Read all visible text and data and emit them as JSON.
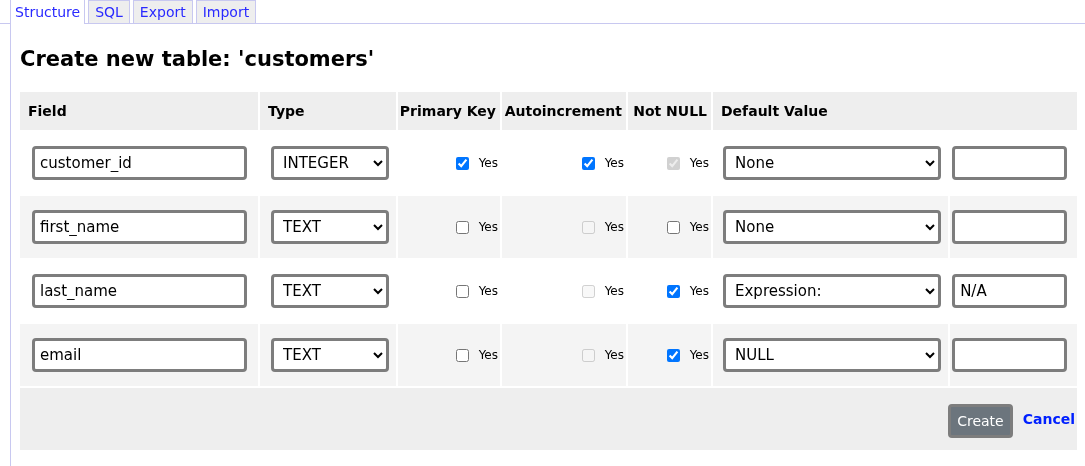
{
  "tabs": [
    {
      "label": "Structure",
      "selected": true
    },
    {
      "label": "SQL",
      "selected": false
    },
    {
      "label": "Export",
      "selected": false
    },
    {
      "label": "Import",
      "selected": false
    }
  ],
  "heading": "Create new table: 'customers'",
  "table": {
    "columns": [
      "Field",
      "Type",
      "Primary Key",
      "Autoincrement",
      "Not NULL",
      "Default Value"
    ],
    "rows": [
      {
        "field": "customer_id",
        "type": "INTEGER",
        "primary_key": {
          "label": "Yes",
          "checked": true,
          "disabled": false
        },
        "autoincrement": {
          "label": "Yes",
          "checked": true,
          "disabled": false
        },
        "not_null": {
          "label": "Yes",
          "checked": true,
          "disabled": true
        },
        "default": "None",
        "default_value": ""
      },
      {
        "field": "first_name",
        "type": "TEXT",
        "primary_key": {
          "label": "Yes",
          "checked": false,
          "disabled": false
        },
        "autoincrement": {
          "label": "Yes",
          "checked": false,
          "disabled": true
        },
        "not_null": {
          "label": "Yes",
          "checked": false,
          "disabled": false
        },
        "default": "None",
        "default_value": ""
      },
      {
        "field": "last_name",
        "type": "TEXT",
        "primary_key": {
          "label": "Yes",
          "checked": false,
          "disabled": false
        },
        "autoincrement": {
          "label": "Yes",
          "checked": false,
          "disabled": true
        },
        "not_null": {
          "label": "Yes",
          "checked": true,
          "disabled": false
        },
        "default": "Expression:",
        "default_value": "N/A"
      },
      {
        "field": "email",
        "type": "TEXT",
        "primary_key": {
          "label": "Yes",
          "checked": false,
          "disabled": false
        },
        "autoincrement": {
          "label": "Yes",
          "checked": false,
          "disabled": true
        },
        "not_null": {
          "label": "Yes",
          "checked": true,
          "disabled": false
        },
        "default": "NULL",
        "default_value": ""
      }
    ]
  },
  "buttons": {
    "create": "Create",
    "cancel": "Cancel"
  }
}
